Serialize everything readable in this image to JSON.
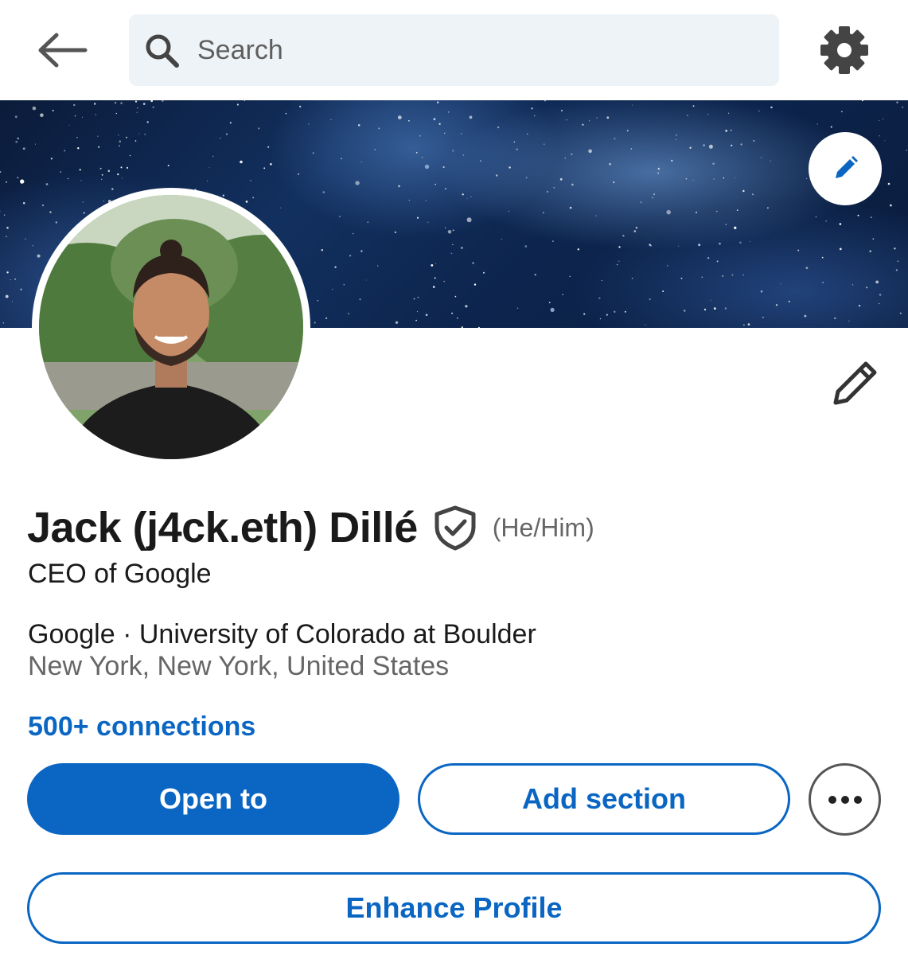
{
  "header": {
    "search_placeholder": "Search"
  },
  "profile": {
    "name": "Jack (j4ck.eth) Dillé",
    "pronouns": "(He/Him)",
    "headline": "CEO of Google",
    "orgs": "Google · University of Colorado at Boulder",
    "location": "New York, New York, United States",
    "connections": "500+ connections"
  },
  "actions": {
    "open_to": "Open to",
    "add_section": "Add section",
    "enhance_profile": "Enhance Profile"
  },
  "colors": {
    "accent": "#0a66c2",
    "search_bg": "#eef3f8"
  },
  "icons": {
    "back": "back-arrow-icon",
    "search": "search-icon",
    "settings": "gear-icon",
    "edit": "pencil-icon",
    "verified": "shield-check-icon",
    "more": "ellipsis-icon"
  }
}
